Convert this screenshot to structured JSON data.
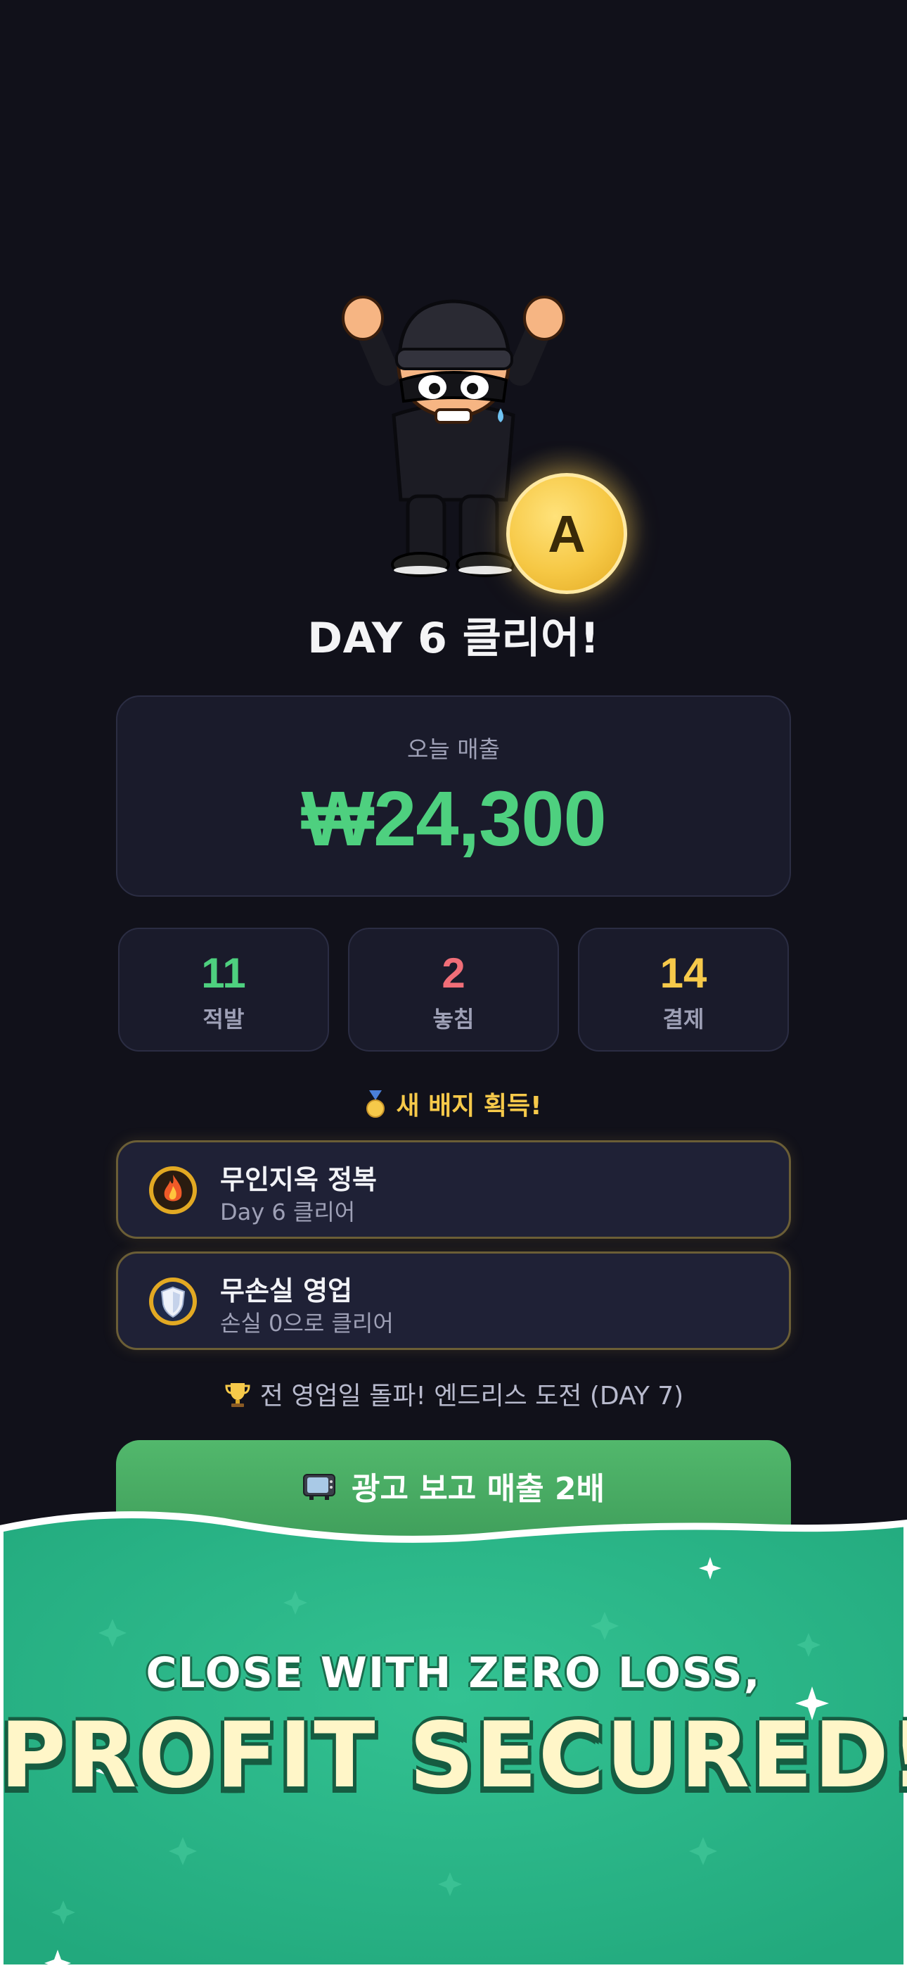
{
  "result": {
    "grade": "A",
    "title": "DAY 6 클리어!"
  },
  "revenue": {
    "label": "오늘 매출",
    "value": "₩24,300",
    "color": "#4ed07f"
  },
  "stats": [
    {
      "value": "11",
      "label": "적발",
      "color": "#4ed07f"
    },
    {
      "value": "2",
      "label": "놓침",
      "color": "#f06e78"
    },
    {
      "value": "14",
      "label": "결제",
      "color": "#f6c94a"
    }
  ],
  "badges": {
    "heading": "새 배지 획득!",
    "items": [
      {
        "title": "무인지옥 정복",
        "subtitle": "Day 6 클리어",
        "icon": "flame-badge-icon"
      },
      {
        "title": "무손실 영업",
        "subtitle": "손실 0으로 클리어",
        "icon": "shield-badge-icon"
      }
    ]
  },
  "endless_notice": "전 영업일 돌파! 엔드리스 도전 (DAY 7)",
  "ad_button": {
    "label": "광고 보고 매출 2배",
    "icon": "tv-icon"
  },
  "promo": {
    "line1": "CLOSE WITH ZERO LOSS,",
    "line2": "PROFIT SECURED!",
    "background": "#27b386"
  }
}
